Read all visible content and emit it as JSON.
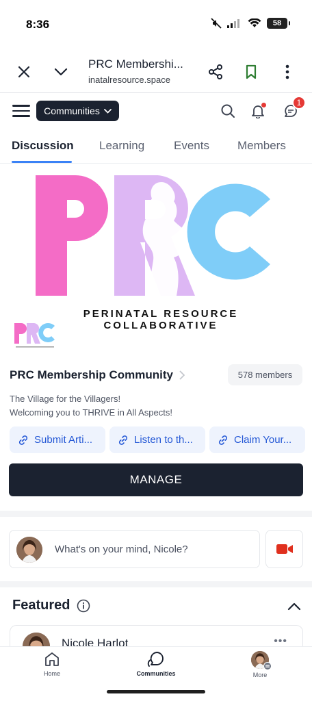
{
  "status_bar": {
    "time": "8:36",
    "battery": "58"
  },
  "browser": {
    "page_title": "PRC Membershi...",
    "url": "inatalresource.space"
  },
  "header": {
    "communities_label": "Communities",
    "chat_badge_count": "1"
  },
  "tabs": [
    {
      "label": "Discussion",
      "active": true
    },
    {
      "label": "Learning",
      "active": false
    },
    {
      "label": "Events",
      "active": false
    },
    {
      "label": "Members",
      "active": false
    }
  ],
  "banner": {
    "logo_letters": "PRC",
    "tagline": "PERINATAL RESOURCE COLLABORATIVE",
    "colors": {
      "pink": "#f46cc6",
      "lavender": "#ddb7f4",
      "blue": "#7fcdf8"
    }
  },
  "community": {
    "name": "PRC Membership Community",
    "member_count": "578 members",
    "description_line1": "The Village for the Villagers!",
    "description_line2": "Welcoming you to THRIVE in All Aspects!"
  },
  "quick_links": [
    {
      "label": "Submit Arti..."
    },
    {
      "label": "Listen to th..."
    },
    {
      "label": "Claim Your..."
    }
  ],
  "manage_label": "MANAGE",
  "composer": {
    "placeholder": "What's on your mind, Nicole?"
  },
  "featured": {
    "title": "Featured",
    "post_author": "Nicole Harlot",
    "more_label": "•••"
  },
  "bottom_nav": [
    {
      "label": "Home",
      "icon": "home-icon"
    },
    {
      "label": "Communities",
      "icon": "communities-icon"
    },
    {
      "label": "More",
      "icon": "avatar"
    }
  ],
  "accent_colors": {
    "primary_dark": "#1b2230",
    "link_blue": "#2458d6",
    "tab_underline": "#3b82f6",
    "notification_red": "#e53935",
    "video_red": "#e0301e"
  }
}
